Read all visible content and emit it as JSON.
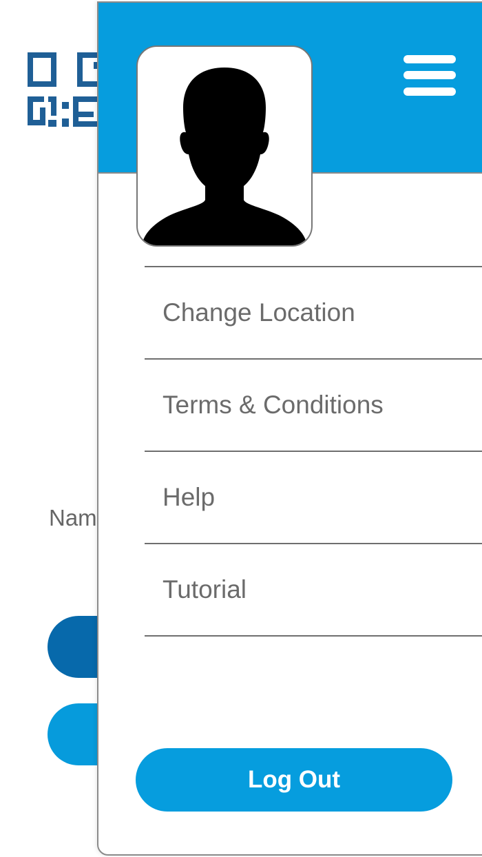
{
  "background_page": {
    "name_label_partial": "Nam",
    "qr_icon": "qr-code-icon",
    "colors": {
      "qr": "#1f5f96",
      "primary_button": "#0769ab",
      "secondary_button": "#069bdc"
    }
  },
  "drawer": {
    "header_color": "#069dde",
    "menu_icon": "hamburger-menu-icon",
    "avatar_icon": "user-silhouette-icon",
    "menu_items": [
      {
        "label": "Change Location"
      },
      {
        "label": "Terms & Conditions"
      },
      {
        "label": "Help"
      },
      {
        "label": "Tutorial"
      }
    ],
    "logout_label": "Log Out"
  }
}
